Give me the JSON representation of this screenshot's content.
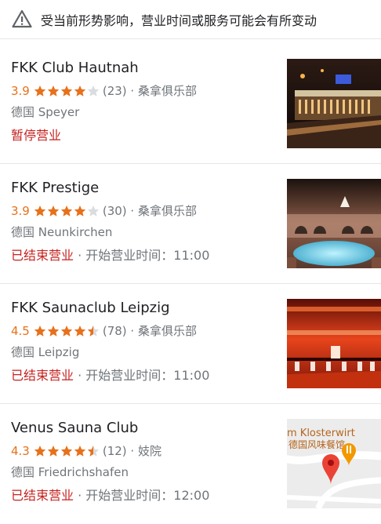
{
  "notice": {
    "icon": "warning-icon",
    "text": "受当前形势影响，营业时间或服务可能会有所变动"
  },
  "colors": {
    "star_filled": "#e7711b",
    "star_empty": "#dadce0",
    "closed_status": "#c5221f",
    "secondary_text": "#70757a"
  },
  "listings": [
    {
      "name": "FKK Club Hautnah",
      "rating": "3.9",
      "stars": 3.9,
      "reviews": "(23)",
      "sep": " · ",
      "category": "桑拿俱乐部",
      "location": "德国 Speyer",
      "status": "暂停营业",
      "hours": "",
      "thumbnail": "bar-interior-photo"
    },
    {
      "name": "FKK Prestige",
      "rating": "3.9",
      "stars": 3.9,
      "reviews": "(30)",
      "sep": " · ",
      "category": "桑拿俱乐部",
      "location": "德国 Neunkirchen",
      "status": "已结束营业",
      "hours": " · 开始营业时间：11:00",
      "thumbnail": "pool-interior-photo"
    },
    {
      "name": "FKK Saunaclub Leipzig",
      "rating": "4.5",
      "stars": 4.5,
      "reviews": "(78)",
      "sep": " · ",
      "category": "桑拿俱乐部",
      "location": "德国 Leipzig",
      "status": "已结束营业",
      "hours": " · 开始营业时间：11:00",
      "thumbnail": "red-lounge-photo"
    },
    {
      "name": "Venus Sauna Club",
      "rating": "4.3",
      "stars": 4.3,
      "reviews": "(12)",
      "sep": " · ",
      "category": "妓院",
      "location": "德国 Friedrichshafen",
      "status": "已结束营业",
      "hours": " · 开始营业时间：12:00",
      "thumbnail": "map-thumbnail",
      "map": {
        "label_line1": "m Klosterwirt",
        "label_line2": "德国风味餐馆"
      }
    }
  ]
}
